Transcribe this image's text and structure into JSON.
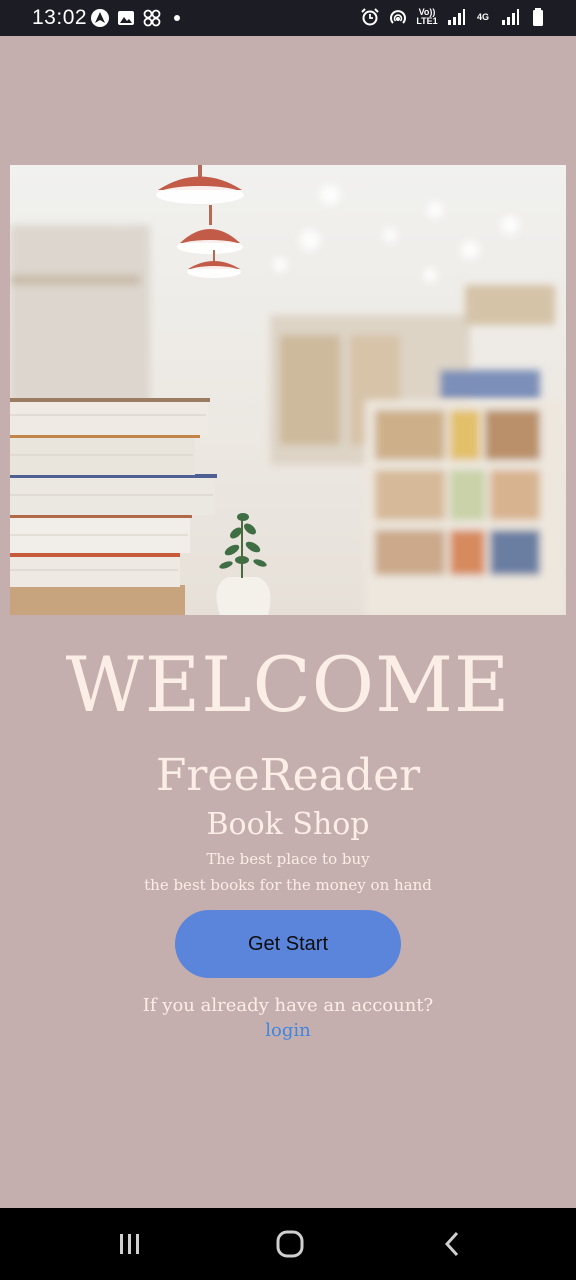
{
  "status_bar": {
    "time": "13:02",
    "left_icons": [
      "navigation-icon",
      "gallery-icon",
      "app-grid-icon",
      "notification-dot"
    ],
    "right_icons": [
      "alarm-icon",
      "hotspot-icon",
      "volte-icon",
      "signal-icon",
      "4g-icon",
      "signal-icon-2",
      "battery-icon"
    ],
    "volte_label": "Vo)) LTE1",
    "network_label": "4G"
  },
  "hero": {
    "description_icon": "bookstore-photo"
  },
  "welcome_title": "WELCOME",
  "app_name": "FreeReader",
  "subtitle": "Book Shop",
  "tagline_line1": "The best place to buy",
  "tagline_line2": "the best books for the money on hand",
  "start_button_label": "Get Start",
  "account_prompt": "If you already have an account?",
  "login_label": "login",
  "colors": {
    "background": "#c5aeae",
    "text": "#fbeee6",
    "button": "#5b85db",
    "link": "#3f86e0"
  },
  "nav_bar": {
    "buttons": [
      "recent-apps-icon",
      "home-icon",
      "back-icon"
    ]
  }
}
